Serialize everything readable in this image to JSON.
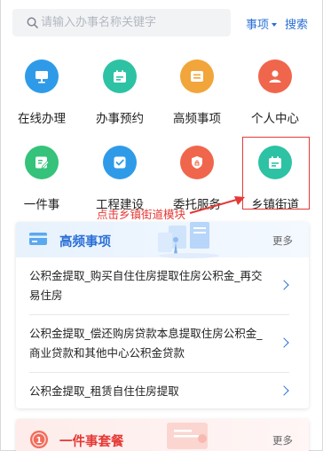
{
  "search": {
    "placeholder": "请输入办事名称关键字",
    "scope": "事项",
    "button": "搜索"
  },
  "services": [
    {
      "label": "在线办理",
      "icon": "monitor-icon",
      "color": "#2f9be8"
    },
    {
      "label": "办事预约",
      "icon": "calendar-icon",
      "color": "#2dc2a4"
    },
    {
      "label": "高频事项",
      "icon": "list-icon",
      "color": "#f2a53a"
    },
    {
      "label": "个人中心",
      "icon": "person-icon",
      "color": "#f0664c"
    },
    {
      "label": "一件事",
      "icon": "edit-icon",
      "color": "#35c27a"
    },
    {
      "label": "工程建设",
      "icon": "check-icon",
      "color": "#2f9be8"
    },
    {
      "label": "委托服务",
      "icon": "shield-icon",
      "color": "#f0664c"
    },
    {
      "label": "乡镇街道",
      "icon": "calendar-icon",
      "color": "#2dc2a4"
    }
  ],
  "annotation": {
    "text": "点击乡镇街道模块",
    "color": "#e53935"
  },
  "high_frequency": {
    "title": "高频事项",
    "more": "更多",
    "items": [
      "公积金提取_购买自住住房提取住房公积金_再交易住房",
      "公积金提取_偿还购房贷款本息提取住房公积金_商业贷款和其他中心公积金贷款",
      "公积金提取_租赁自住住房提取"
    ]
  },
  "one_thing": {
    "badge": "1",
    "title": "一件事套餐",
    "more": "更多"
  },
  "colors": {
    "accent": "#2a6fd6",
    "alert": "#e53935"
  }
}
